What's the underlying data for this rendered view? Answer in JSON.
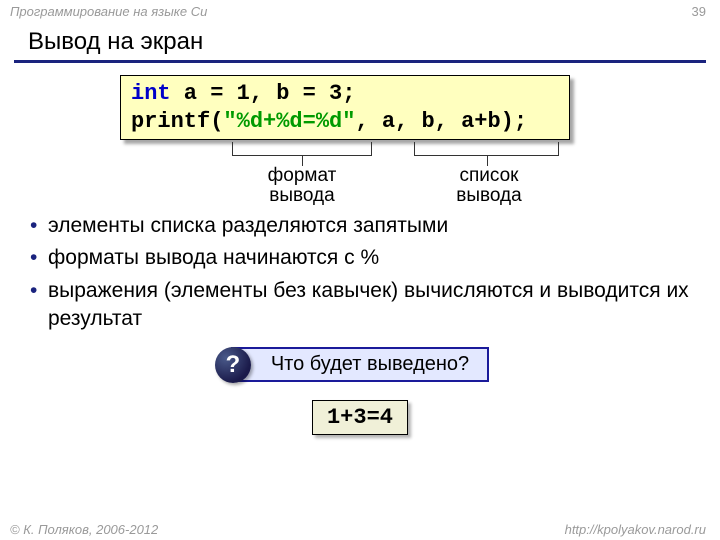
{
  "header": {
    "course": "Программирование на языке Си",
    "page": "39"
  },
  "title": "Вывод на экран",
  "code": {
    "line1": {
      "kw": "int",
      "rest": " a = 1, b = 3;"
    },
    "line2": {
      "fn": "printf(",
      "str": "\"%d+%d=%d\"",
      "args": ", a, b, a+b);"
    }
  },
  "annot": {
    "left": "формат\nвывода",
    "right": "список\nвывода"
  },
  "bullets": [
    "элементы списка разделяются запятыми",
    "форматы вывода начинаются с %",
    "выражения (элементы без кавычек) вычисляются и выводится их результат"
  ],
  "question": {
    "badge": "?",
    "text": "Что будет выведено?"
  },
  "answer": "1+3=4",
  "footer": {
    "copyright": "© К. Поляков, 2006-2012",
    "url": "http://kpolyakov.narod.ru"
  }
}
